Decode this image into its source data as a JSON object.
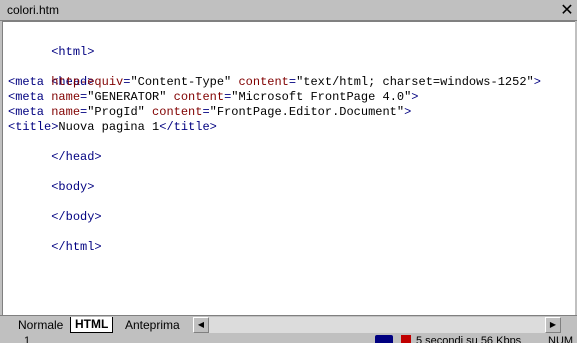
{
  "window": {
    "title": "colori.htm",
    "close_glyph": "✕"
  },
  "code": {
    "lines": [
      {
        "type": "tag",
        "text": "<html>"
      },
      {
        "type": "blank",
        "text": ""
      },
      {
        "type": "tag",
        "text": "<head>"
      },
      {
        "type": "meta1",
        "text": "<meta http-equiv=\"Content-Type\" content=\"text/html; charset=windows-1252\">"
      },
      {
        "type": "meta2",
        "text": "<meta name=\"GENERATOR\" content=\"Microsoft FrontPage 4.0\">"
      },
      {
        "type": "meta3",
        "text": "<meta name=\"ProgId\" content=\"FrontPage.Editor.Document\">"
      },
      {
        "type": "title",
        "text": "<title>Nuova pagina 1</title>"
      },
      {
        "type": "tag",
        "text": "</head>"
      },
      {
        "type": "blank",
        "text": ""
      },
      {
        "type": "tag",
        "text": "<body>"
      },
      {
        "type": "blank",
        "text": ""
      },
      {
        "type": "tag",
        "text": "</body>"
      },
      {
        "type": "blank",
        "text": ""
      },
      {
        "type": "tag",
        "text": "</html>"
      }
    ],
    "l0": "<html>",
    "l2": "<head>",
    "meta1_open": "<meta ",
    "meta1_attr1": "http-equiv",
    "meta1_eq1": "=",
    "meta1_val1": "\"Content-Type\"",
    "meta1_attr2": " content",
    "meta1_eq2": "=",
    "meta1_val2": "\"text/html; charset=windows-1252\"",
    "meta1_close": ">",
    "meta2_open": "<meta ",
    "meta2_attr1": "name",
    "meta2_eq1": "=",
    "meta2_val1": "\"GENERATOR\"",
    "meta2_attr2": " content",
    "meta2_eq2": "=",
    "meta2_val2": "\"Microsoft FrontPage 4.0\"",
    "meta2_close": ">",
    "meta3_open": "<meta ",
    "meta3_attr1": "name",
    "meta3_eq1": "=",
    "meta3_val1": "\"ProgId\"",
    "meta3_attr2": " content",
    "meta3_eq2": "=",
    "meta3_val2": "\"FrontPage.Editor.Document\"",
    "meta3_close": ">",
    "title_open": "<title>",
    "title_text": "Nuova pagina 1",
    "title_close": "</title>",
    "l7": "</head>",
    "l9": "<body>",
    "l11": "</body>",
    "l13": "</html>"
  },
  "tabs": {
    "normale": "Normale",
    "html": "HTML",
    "anteprima": "Anteprima",
    "scroll_left_glyph": "◀",
    "scroll_right_glyph": "▶"
  },
  "status": {
    "line": "1",
    "time": "5 secondi su 56 Kbps",
    "num": "NUM"
  },
  "colors": {
    "tag": "#000080",
    "attribute": "#800000",
    "value": "#000000",
    "chrome": "#c0c0c0"
  }
}
